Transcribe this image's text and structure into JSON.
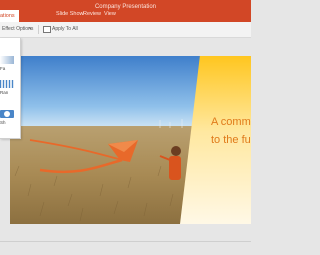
{
  "app": {
    "title": "Company Presentation"
  },
  "ribbon": {
    "tabs": [
      {
        "label": "ations",
        "active": true
      },
      {
        "label": "Slide Show",
        "active": false
      },
      {
        "label": "Review",
        "active": false
      },
      {
        "label": "View",
        "active": false
      }
    ]
  },
  "command_bar": {
    "effect_options_label": "Effect Options",
    "apply_to_all_label": "Apply To All"
  },
  "dropdown": {
    "items": [
      {
        "label": "Fa"
      },
      {
        "label": "Ran"
      },
      {
        "label": "Sh"
      }
    ]
  },
  "slide": {
    "lines": [
      "A comm",
      "to the fu"
    ]
  },
  "colors": {
    "title_bar": "#d24726",
    "slide_text": "#e07a1a",
    "accent": "#ffc928"
  }
}
